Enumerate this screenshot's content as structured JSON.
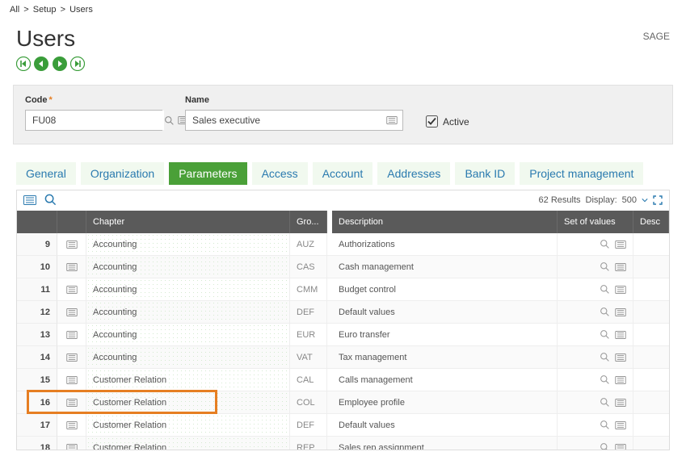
{
  "breadcrumb": {
    "root": "All",
    "mid": "Setup",
    "leaf": "Users"
  },
  "brand": "SAGE",
  "title": "Users",
  "form": {
    "code_label": "Code",
    "code_value": "FU08",
    "name_label": "Name",
    "name_value": "Sales executive",
    "active_label": "Active"
  },
  "tabs": [
    {
      "label": "General",
      "active": false
    },
    {
      "label": "Organization",
      "active": false
    },
    {
      "label": "Parameters",
      "active": true
    },
    {
      "label": "Access",
      "active": false
    },
    {
      "label": "Account",
      "active": false
    },
    {
      "label": "Addresses",
      "active": false
    },
    {
      "label": "Bank ID",
      "active": false
    },
    {
      "label": "Project management",
      "active": false
    }
  ],
  "results": {
    "count_text": "62 Results",
    "display_label": "Display:",
    "display_value": "500"
  },
  "headers": {
    "chapter": "Chapter",
    "group": "Gro...",
    "description": "Description",
    "setv": "Set of values",
    "desc2": "Desc"
  },
  "rows": [
    {
      "n": "9",
      "chapter": "Accounting",
      "group": "AUZ",
      "desc": "Authorizations"
    },
    {
      "n": "10",
      "chapter": "Accounting",
      "group": "CAS",
      "desc": "Cash management"
    },
    {
      "n": "11",
      "chapter": "Accounting",
      "group": "CMM",
      "desc": "Budget control"
    },
    {
      "n": "12",
      "chapter": "Accounting",
      "group": "DEF",
      "desc": "Default values"
    },
    {
      "n": "13",
      "chapter": "Accounting",
      "group": "EUR",
      "desc": "Euro transfer"
    },
    {
      "n": "14",
      "chapter": "Accounting",
      "group": "VAT",
      "desc": "Tax management"
    },
    {
      "n": "15",
      "chapter": "Customer Relation",
      "group": "CAL",
      "desc": "Calls management"
    },
    {
      "n": "16",
      "chapter": "Customer Relation",
      "group": "COL",
      "desc": "Employee profile",
      "highlight": true
    },
    {
      "n": "17",
      "chapter": "Customer Relation",
      "group": "DEF",
      "desc": "Default values"
    },
    {
      "n": "18",
      "chapter": "Customer Relation",
      "group": "REP",
      "desc": "Sales rep assignment"
    }
  ]
}
